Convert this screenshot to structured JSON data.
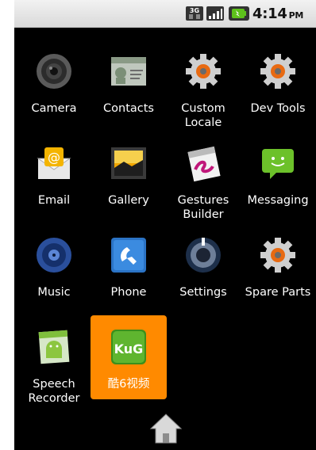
{
  "status_bar": {
    "time": "4:14",
    "ampm": "PM",
    "icons": [
      "3g-icon",
      "signal-icon",
      "battery-icon"
    ]
  },
  "apps": [
    {
      "label": "Camera",
      "icon": "camera-icon"
    },
    {
      "label": "Contacts",
      "icon": "contacts-icon"
    },
    {
      "label": "Custom\nLocale",
      "icon": "gear-icon"
    },
    {
      "label": "Dev Tools",
      "icon": "gear-icon"
    },
    {
      "label": "Email",
      "icon": "email-icon"
    },
    {
      "label": "Gallery",
      "icon": "gallery-icon"
    },
    {
      "label": "Gestures\nBuilder",
      "icon": "gestures-icon"
    },
    {
      "label": "Messaging",
      "icon": "messaging-icon"
    },
    {
      "label": "Music",
      "icon": "music-icon"
    },
    {
      "label": "Phone",
      "icon": "phone-icon"
    },
    {
      "label": "Settings",
      "icon": "settings-icon"
    },
    {
      "label": "Spare Parts",
      "icon": "gear-icon"
    },
    {
      "label": "Speech\nRecorder",
      "icon": "android-icon"
    },
    {
      "label": "酷6视频",
      "icon": "ku6-icon",
      "selected": true
    }
  ],
  "home": {
    "icon": "home-icon"
  },
  "colors": {
    "background": "#000000",
    "status_bar": "#e6e6e6",
    "selection": "#ff8a00"
  }
}
